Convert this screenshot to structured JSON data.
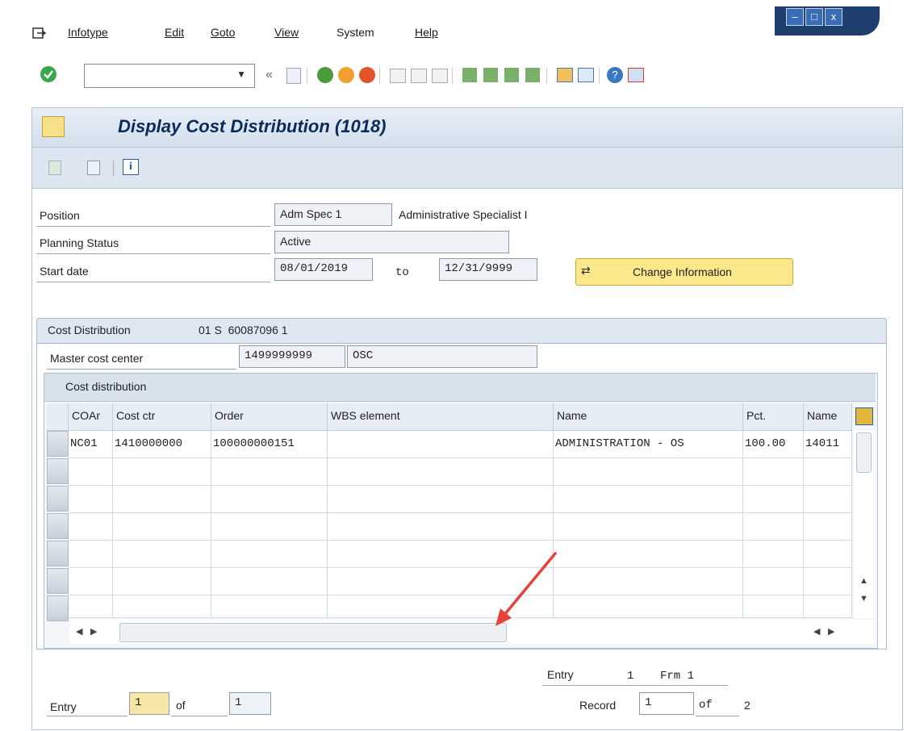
{
  "menu": [
    "Infotype",
    "Edit",
    "Goto",
    "View",
    "System",
    "Help"
  ],
  "window_controls": {
    "minimize": "–",
    "maximize": "□",
    "close": "x"
  },
  "toolbar": {
    "command_value": ""
  },
  "title": "Display Cost Distribution (1018)",
  "form": {
    "position_label": "Position",
    "position_value": "Adm Spec 1",
    "position_text": "Administrative Specialist I",
    "planning_label": "Planning Status",
    "planning_value": "Active",
    "start_label": "Start date",
    "start_value": "08/01/2019",
    "to_label": "to",
    "end_value": "12/31/9999",
    "change_button": "Change Information"
  },
  "group": {
    "title": "Cost Distribution",
    "id": "01 S  60087096 1",
    "master_label": "Master cost center",
    "master_value": "1499999999",
    "master_text": "OSC"
  },
  "table": {
    "title": "Cost distribution",
    "columns": [
      "COAr",
      "Cost ctr",
      "Order",
      "WBS element",
      "Name",
      "Pct.",
      "Name"
    ],
    "rows": [
      [
        "NC01",
        "1410000000",
        "100000000151",
        "",
        "ADMINISTRATION - OS",
        "100.00",
        "14011"
      ]
    ]
  },
  "footer": {
    "entry_label": "Entry",
    "entry_value": "1",
    "of_label": "of",
    "total_value": "1",
    "entry2_label": "Entry",
    "entry2_value": "1",
    "frm_label": "Frm 1",
    "record_label": "Record",
    "record_value": "1",
    "of2_label": "of",
    "record_total": "2"
  },
  "colors": {
    "accent_title": "#0b2a5a",
    "button_bg": "#fbe88a",
    "annotation_arrow": "#e8413c"
  }
}
